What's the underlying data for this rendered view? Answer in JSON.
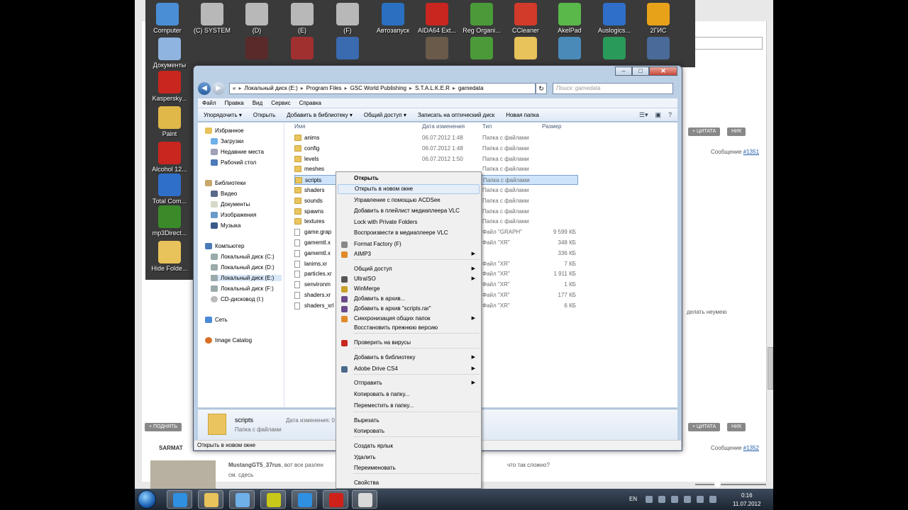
{
  "desktop": {
    "top_icons": [
      {
        "label": "Computer",
        "color": "#4a8fd6"
      },
      {
        "label": "(C) SYSTEM",
        "color": "#b8b8b8"
      },
      {
        "label": "(D)",
        "color": "#b8b8b8"
      },
      {
        "label": "(E)",
        "color": "#b8b8b8"
      },
      {
        "label": "(F)",
        "color": "#b8b8b8"
      },
      {
        "label": "Автозапуск",
        "color": "#2a6fc0"
      },
      {
        "label": "AIDA64 Ext...",
        "color": "#c8261f"
      },
      {
        "label": "Reg Organi...",
        "color": "#4a9a3a"
      },
      {
        "label": "CCleaner",
        "color": "#d23a2a"
      },
      {
        "label": "AkelPad",
        "color": "#5ab84a"
      },
      {
        "label": "Auslogics...",
        "color": "#2f6fc9"
      },
      {
        "label": "2ГИС",
        "color": "#e8a21a"
      }
    ],
    "left_icons": [
      {
        "label": "Документы",
        "color": "#8fb4e0"
      },
      {
        "label": "Kaspersky...",
        "color": "#c8261f"
      },
      {
        "label": "Paint",
        "color": "#e0b84a"
      },
      {
        "label": "Alcohol 12...",
        "color": "#c8261f"
      },
      {
        "label": "Total Com...",
        "color": "#2f6fc9"
      },
      {
        "label": "mp3Direct...",
        "color": "#3a8a2a"
      },
      {
        "label": "Hide Folde...",
        "color": "#e8c25a"
      }
    ]
  },
  "background_page": {
    "quote_button": "+ ЦИТАТА",
    "nick_button": "НИК",
    "message_label_1": "Сообщение ",
    "message_link_1": "#1351",
    "message_label_2": "Сообщение ",
    "message_link_2": "#1352",
    "side_text": "делать неумею",
    "up_button": "+ ПОДНЯТЬ",
    "user_name": "SARMAT",
    "poster": "MustangGT5_37rus",
    "post_text": ", вот все разлен",
    "post_text_2": "что так сложно?",
    "post_text_3": "см. сдесь"
  },
  "explorer": {
    "close": "✕",
    "maximize": "□",
    "minimize": "–",
    "back": "◀",
    "forward": "▶",
    "address_start": "«",
    "breadcrumb": [
      "Локальный диск (E:)",
      "Program Files",
      "GSC World Publishing",
      "S.T.A.L.K.E.R",
      "gamedata"
    ],
    "refresh": "↻",
    "search_placeholder": "Поиск: gamedata",
    "menu": [
      "Файл",
      "Правка",
      "Вид",
      "Сервис",
      "Справка"
    ],
    "toolbar": [
      "Упорядочить ▾",
      "Открыть",
      "Добавить в библиотеку ▾",
      "Общий доступ ▾",
      "Записать на оптический диск",
      "Новая папка"
    ],
    "nav": {
      "favorites": "Избранное",
      "downloads": "Загрузки",
      "recent": "Недавние места",
      "desktop": "Рабочий стол",
      "libraries": "Библиотеки",
      "video": "Видео",
      "documents": "Документы",
      "images": "Изображения",
      "music": "Музыка",
      "computer": "Компьютер",
      "disk_c": "Локальный диск (C:)",
      "disk_d": "Локальный диск (D:)",
      "disk_e": "Локальный диск (E:)",
      "disk_f": "Локальный диск (F:)",
      "cd": "CD-дисковод (I:)",
      "network": "Сеть",
      "catalog": "Image Catalog"
    },
    "columns": {
      "name": "Имя",
      "date": "Дата изменения",
      "type": "Тип",
      "size": "Размер"
    },
    "files": [
      {
        "name": "anims",
        "date": "06.07.2012 1:48",
        "type": "Папка с файлами",
        "size": "",
        "kind": "folder"
      },
      {
        "name": "config",
        "date": "06.07.2012 1:48",
        "type": "Папка с файлами",
        "size": "",
        "kind": "folder"
      },
      {
        "name": "levels",
        "date": "06.07.2012 1:50",
        "type": "Папка с файлами",
        "size": "",
        "kind": "folder"
      },
      {
        "name": "meshes",
        "date": "",
        "type": "Папка с файлами",
        "size": "",
        "kind": "folder"
      },
      {
        "name": "scripts",
        "date": "",
        "type": "Папка с файлами",
        "size": "",
        "kind": "folder"
      },
      {
        "name": "shaders",
        "date": "",
        "type": "Папка с файлами",
        "size": "",
        "kind": "folder"
      },
      {
        "name": "sounds",
        "date": "",
        "type": "Папка с файлами",
        "size": "",
        "kind": "folder"
      },
      {
        "name": "spawns",
        "date": "",
        "type": "Папка с файлами",
        "size": "",
        "kind": "folder"
      },
      {
        "name": "textures",
        "date": "",
        "type": "Папка с файлами",
        "size": "",
        "kind": "folder"
      },
      {
        "name": "game.grap",
        "date": "",
        "type": "Файл \"GRAPH\"",
        "size": "9 599 КБ",
        "kind": "file"
      },
      {
        "name": "gamemtl.x",
        "date": "",
        "type": "Файл \"XR\"",
        "size": "348 КБ",
        "kind": "file"
      },
      {
        "name": "gamemtl.x",
        "date": "",
        "type": "",
        "size": "336 КБ",
        "kind": "file"
      },
      {
        "name": "lanims.xr",
        "date": "",
        "type": "Файл \"XR\"",
        "size": "7 КБ",
        "kind": "file"
      },
      {
        "name": "particles.xr",
        "date": "",
        "type": "Файл \"XR\"",
        "size": "1 911 КБ",
        "kind": "file"
      },
      {
        "name": "senvironm",
        "date": "",
        "type": "Файл \"XR\"",
        "size": "1 КБ",
        "kind": "file"
      },
      {
        "name": "shaders.xr",
        "date": "",
        "type": "Файл \"XR\"",
        "size": "177 КБ",
        "kind": "file"
      },
      {
        "name": "shaders_xrl",
        "date": "",
        "type": "Файл \"XR\"",
        "size": "6 КБ",
        "kind": "file"
      }
    ],
    "details": {
      "name": "scripts",
      "type": "Папка с файлами",
      "label": "Дата изменения: 0"
    },
    "status": "Открыть в новом окне"
  },
  "context_menu": [
    {
      "label": "Открыть",
      "bold": true,
      "submenu": false,
      "icon": ""
    },
    {
      "label": "Открыть в новом окне",
      "bold": false,
      "submenu": false,
      "icon": "",
      "hover": true
    },
    {
      "label": "Управление с помощью ACDSee",
      "bold": false,
      "submenu": false,
      "icon": ""
    },
    {
      "label": "Добавить в плейлист медиаплеера VLC",
      "bold": false,
      "submenu": false,
      "icon": ""
    },
    {
      "label": "Lock with Private Folders",
      "bold": false,
      "submenu": false,
      "icon": ""
    },
    {
      "label": "Воспроизвести в медиаплеере VLC",
      "bold": false,
      "submenu": false,
      "icon": ""
    },
    {
      "label": "Format Factory (F)",
      "bold": false,
      "submenu": false,
      "icon": "#888"
    },
    {
      "label": "AIMP3",
      "bold": false,
      "submenu": true,
      "icon": "#e08a2a"
    },
    {
      "label": "Общий доступ",
      "bold": false,
      "submenu": true,
      "icon": ""
    },
    {
      "label": "UltraISO",
      "bold": false,
      "submenu": true,
      "icon": "#555"
    },
    {
      "label": "WinMerge",
      "bold": false,
      "submenu": false,
      "icon": "#c8a02a"
    },
    {
      "label": "Добавить в архив...",
      "bold": false,
      "submenu": false,
      "icon": "#6a4a8a"
    },
    {
      "label": "Добавить в архив \"scripts.rar\"",
      "bold": false,
      "submenu": false,
      "icon": "#6a4a8a"
    },
    {
      "label": "Синхронизация общих папок",
      "bold": false,
      "submenu": true,
      "icon": "#e08a2a"
    },
    {
      "label": "Восстановить прежнюю версию",
      "bold": false,
      "submenu": false,
      "icon": ""
    },
    {
      "label": "Проверить на вирусы",
      "bold": false,
      "submenu": false,
      "icon": "#c8261f"
    },
    {
      "label": "Добавить в библиотеку",
      "bold": false,
      "submenu": true,
      "icon": ""
    },
    {
      "label": "Adobe Drive CS4",
      "bold": false,
      "submenu": true,
      "icon": "#4a6a8a"
    },
    {
      "label": "Отправить",
      "bold": false,
      "submenu": true,
      "icon": ""
    },
    {
      "label": "Копировать в папку...",
      "bold": false,
      "submenu": false,
      "icon": ""
    },
    {
      "label": "Переместить в папку...",
      "bold": false,
      "submenu": false,
      "icon": ""
    },
    {
      "label": "Вырезать",
      "bold": false,
      "submenu": false,
      "icon": ""
    },
    {
      "label": "Копировать",
      "bold": false,
      "submenu": false,
      "icon": ""
    },
    {
      "label": "Создать ярлык",
      "bold": false,
      "submenu": false,
      "icon": ""
    },
    {
      "label": "Удалить",
      "bold": false,
      "submenu": false,
      "icon": ""
    },
    {
      "label": "Переименовать",
      "bold": false,
      "submenu": false,
      "icon": ""
    },
    {
      "label": "Свойства",
      "bold": false,
      "submenu": false,
      "icon": ""
    }
  ],
  "taskbar": {
    "lang": "EN",
    "time": "0:16",
    "date": "11.07.2012",
    "apps": [
      {
        "name": "ie-app",
        "color": "#2f8fe0"
      },
      {
        "name": "explorer-app",
        "color": "#e8c25a"
      },
      {
        "name": "media-app",
        "color": "#6fb0e8"
      },
      {
        "name": "stalker-app",
        "color": "#c8c81a"
      },
      {
        "name": "ie2-app",
        "color": "#2f8fe0"
      },
      {
        "name": "opera-app",
        "color": "#d0201a"
      },
      {
        "name": "window-app",
        "color": "#d8d8d8"
      }
    ]
  }
}
